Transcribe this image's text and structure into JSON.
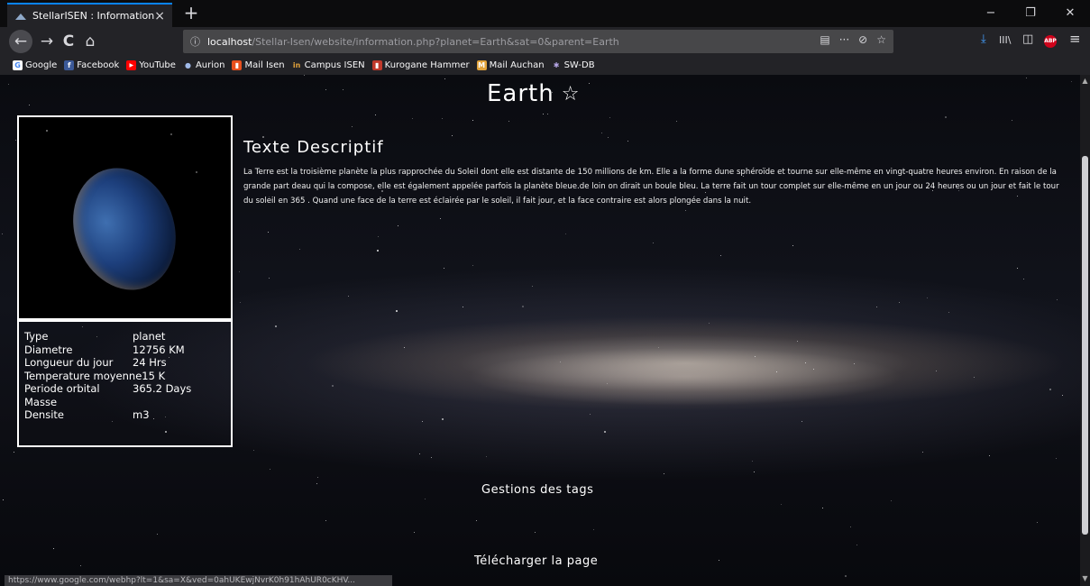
{
  "browser": {
    "tab_title": "StellarISEN : Information",
    "tab_close": "×",
    "new_tab": "+",
    "url_host": "localhost",
    "url_path": "/Stellar-Isen/website/information.php?planet=Earth&sat=0&parent=Earth",
    "url_info": "ⓘ",
    "url_more": "···",
    "url_pocket": "⊘",
    "url_star": "☆",
    "reader": "▤",
    "back": "←",
    "forward": "→",
    "reload": "C",
    "home": "⌂",
    "download": "⤓",
    "library": "III\\",
    "sidebar": "◫",
    "abp": "ABP",
    "menu": "≡",
    "minimize": "−",
    "restore": "❐",
    "close": "✕"
  },
  "bookmarks": [
    {
      "label": "Google",
      "icon": "G",
      "color": "#4285f4"
    },
    {
      "label": "Facebook",
      "icon": "f",
      "color": "#3b5998"
    },
    {
      "label": "YouTube",
      "icon": "▶",
      "color": "#ff0000"
    },
    {
      "label": "Aurion",
      "icon": "●",
      "color": "#3a5fa8"
    },
    {
      "label": "Mail Isen",
      "icon": "▮",
      "color": "#e8501d"
    },
    {
      "label": "Campus ISEN",
      "icon": "in",
      "color": "#e2a33b"
    },
    {
      "label": "Kurogane Hammer",
      "icon": "▮",
      "color": "#c0392b"
    },
    {
      "label": "Mail Auchan",
      "icon": "M",
      "color": "#e2a33b"
    },
    {
      "label": "SW-DB",
      "icon": "✱",
      "color": "#8e7cc3"
    }
  ],
  "page": {
    "title": "Earth",
    "favorite_icon": "☆",
    "desc_heading": "Texte Descriptif",
    "description": "La Terre est la troisième planète la plus rapprochée du Soleil dont elle est distante de 150 millions de km. Elle a la forme dune sphéroïde et tourne sur elle-même en vingt-quatre heures environ. En raison de la grande part deau qui la compose, elle est également appelée parfois la planète bleue.de loin on dirait un boule bleu. La terre fait un tour complet sur elle-même en un jour ou 24 heures ou un jour et fait le tour du soleil en 365 . Quand une face de la terre est éclairée par le soleil, il fait jour, et la face contraire est alors plongée dans la nuit.",
    "info": [
      {
        "key": "Type",
        "value": "planet"
      },
      {
        "key": "Diametre",
        "value": "12756 KM"
      },
      {
        "key": "Longueur du jour",
        "value": "24 Hrs"
      },
      {
        "key": "Temperature moyenne",
        "value": "15 K"
      },
      {
        "key": "Periode orbital",
        "value": "365.2 Days"
      },
      {
        "key": "Masse",
        "value": ""
      },
      {
        "key": "Densite",
        "value": "m3"
      }
    ],
    "tags_link": "Gestions des tags",
    "download_link": "Télécharger la page"
  },
  "status_url": "https://www.google.com/webhp?lt=1&sa=X&ved=0ahUKEwjNvrK0h91hAhUR0cKHV..."
}
